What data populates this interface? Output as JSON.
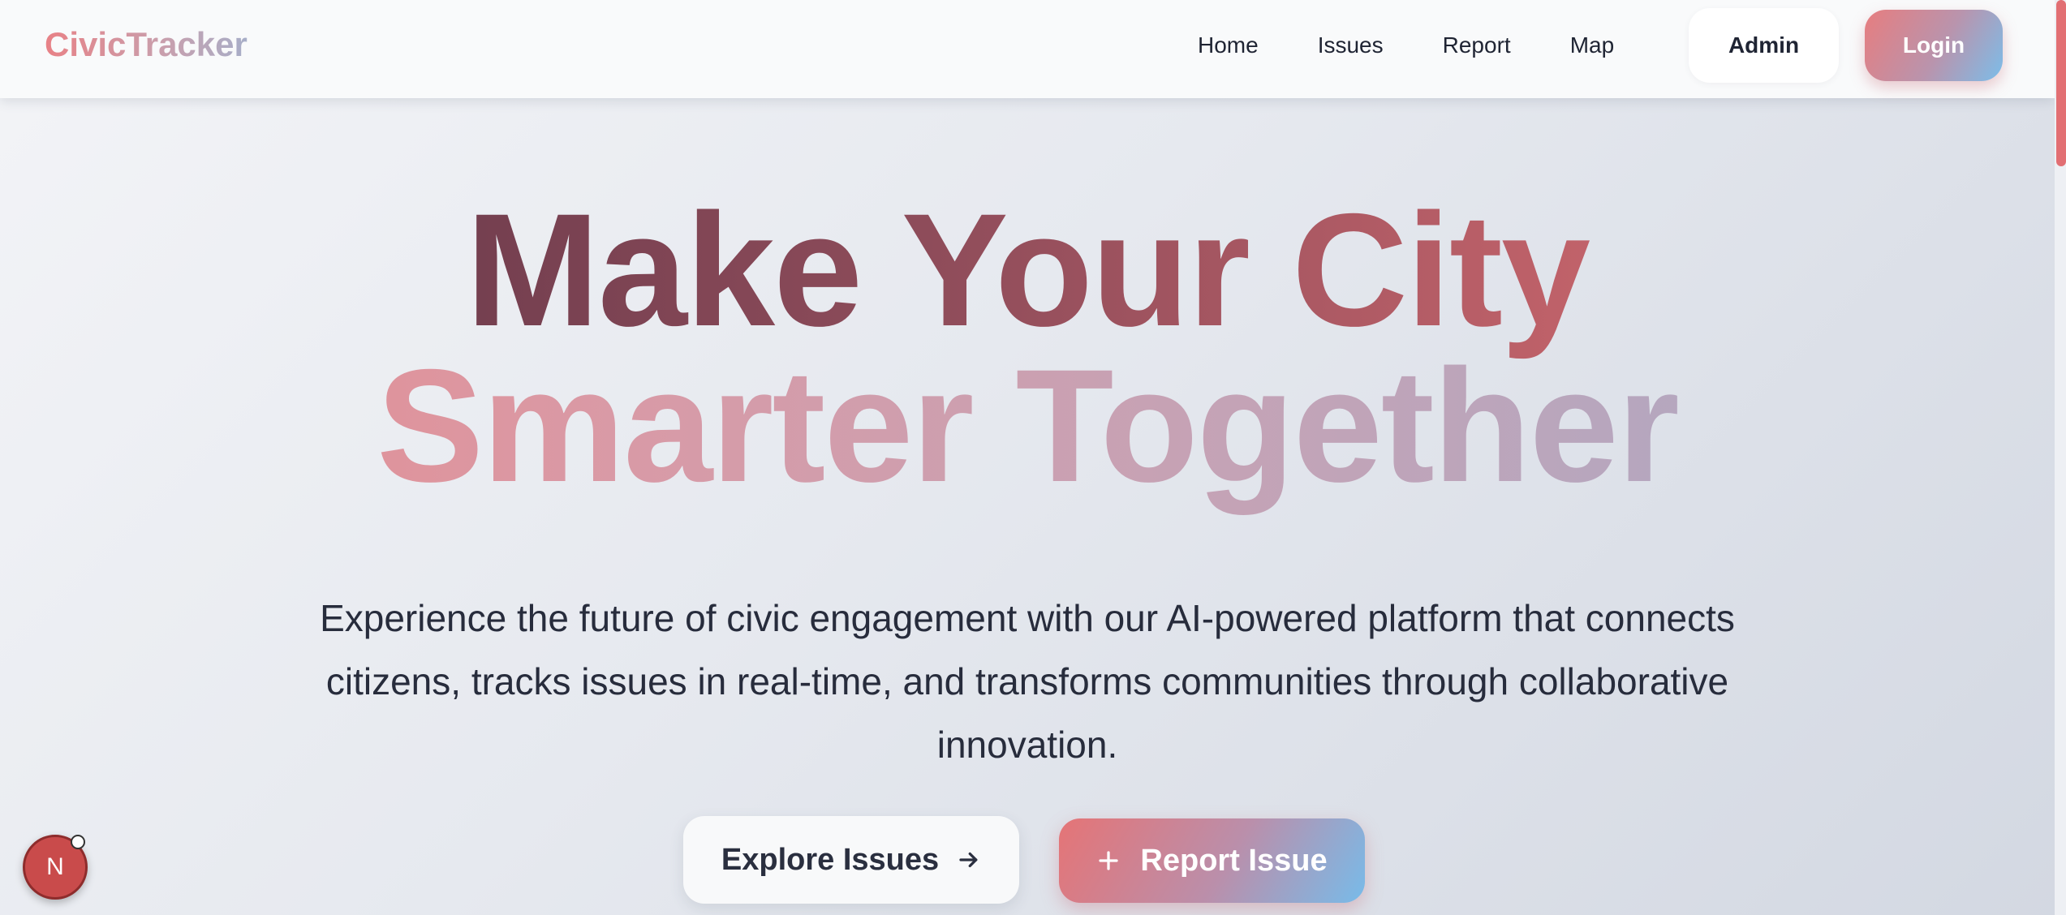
{
  "nav": {
    "brand": "CivicTracker",
    "links": [
      "Home",
      "Issues",
      "Report",
      "Map"
    ],
    "admin_label": "Admin",
    "login_label": "Login"
  },
  "hero": {
    "line1": "Make Your City",
    "line2": "Smarter Together",
    "subtitle": "Experience the future of civic engagement with our AI-powered platform that connects citizens, tracks issues in real-time, and transforms communities through collaborative innovation.",
    "explore_label": "Explore Issues",
    "explore_icon": "arrow-right-icon",
    "report_label": "Report Issue",
    "report_icon": "plus-icon"
  },
  "dev_badge": {
    "letter": "N",
    "icon": "nextjs-dev-indicator-icon"
  },
  "colors": {
    "accent_red": "#e57476",
    "accent_blue": "#78bbe9",
    "headline_dark": "#5a3245",
    "headline_light": "#a9aac6",
    "text": "#272c3c"
  }
}
